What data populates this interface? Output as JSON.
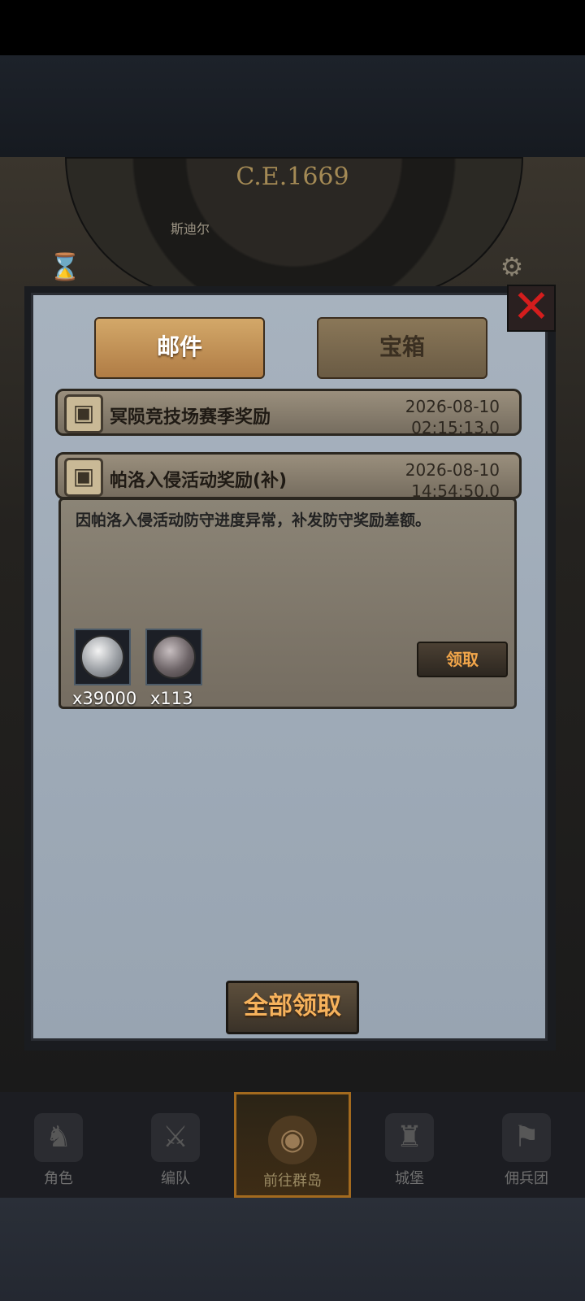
{
  "status_bar": {
    "time": "",
    "indicators": ""
  },
  "background": {
    "era_label": "C.E.1669",
    "place_label": "斯迪尔",
    "icons": [
      "hourglass-icon",
      "gear-icon"
    ]
  },
  "panel": {
    "tabs": [
      {
        "label": "邮件",
        "active": true
      },
      {
        "label": "宝箱",
        "active": false
      }
    ],
    "mails": [
      {
        "title": "冥陨竞技场赛季奖励",
        "date": "2026-08-10",
        "time": "02:15:13.0"
      },
      {
        "title": "帕洛入侵活动奖励(补)",
        "date": "2026-08-10",
        "time": "14:54:50.0"
      }
    ],
    "open_mail": {
      "body": "因帕洛入侵活动防守进度异常，补发防守奖励差额。",
      "rewards": [
        {
          "icon": "silver-coin-icon",
          "qty": "x39000"
        },
        {
          "icon": "dark-medal-icon",
          "qty": "x113"
        }
      ],
      "claim_label": "领取"
    },
    "claim_all_label": "全部领取"
  },
  "bottom_nav": [
    {
      "label": "角色",
      "icon": "character-icon",
      "active": false
    },
    {
      "label": "编队",
      "icon": "formation-icon",
      "active": false
    },
    {
      "label": "前往群岛",
      "icon": "globe-icon",
      "active": true
    },
    {
      "label": "城堡",
      "icon": "castle-icon",
      "active": false
    },
    {
      "label": "佣兵团",
      "icon": "mercenary-icon",
      "active": false
    }
  ]
}
